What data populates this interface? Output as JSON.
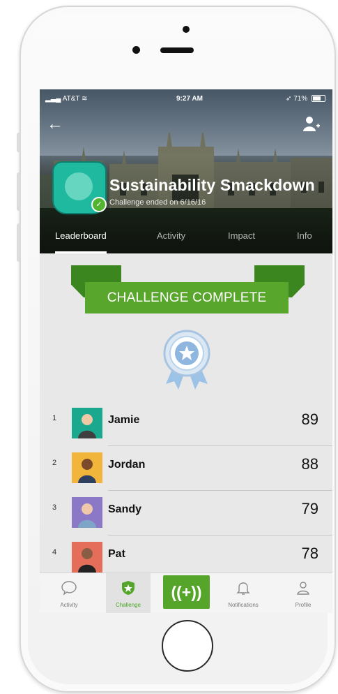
{
  "status_bar": {
    "carrier": "AT&T",
    "time": "9:27 AM",
    "battery": "71%"
  },
  "header": {
    "title": "Sustainability Smackdown",
    "subtitle": "Challenge ended on 6/16/16",
    "tabs": [
      {
        "label": "Leaderboard"
      },
      {
        "label": "Activity"
      },
      {
        "label": "Impact"
      },
      {
        "label": "Info"
      }
    ]
  },
  "banner": {
    "label": "CHALLENGE COMPLETE"
  },
  "leaderboard": [
    {
      "rank": "1",
      "name": "Jamie",
      "score": "89",
      "avatar_color": "#1aa88f"
    },
    {
      "rank": "2",
      "name": "Jordan",
      "score": "88",
      "avatar_color": "#f0b53a"
    },
    {
      "rank": "3",
      "name": "Sandy",
      "score": "79",
      "avatar_color": "#8b78c6"
    },
    {
      "rank": "4",
      "name": "Pat",
      "score": "78",
      "avatar_color": "#e56e5a"
    }
  ],
  "bottom_nav": [
    {
      "label": "Activity",
      "icon": "chat-bubble-icon"
    },
    {
      "label": "Challenge",
      "icon": "shield-star-icon"
    },
    {
      "label": "((+))",
      "icon": "plus-broadcast-icon"
    },
    {
      "label": "Notifications",
      "icon": "bell-icon"
    },
    {
      "label": "Profile",
      "icon": "person-icon"
    }
  ],
  "colors": {
    "brand_green": "#54a52a",
    "ribbon_dark": "#3c861f",
    "badge_teal": "#1fb9a0"
  }
}
